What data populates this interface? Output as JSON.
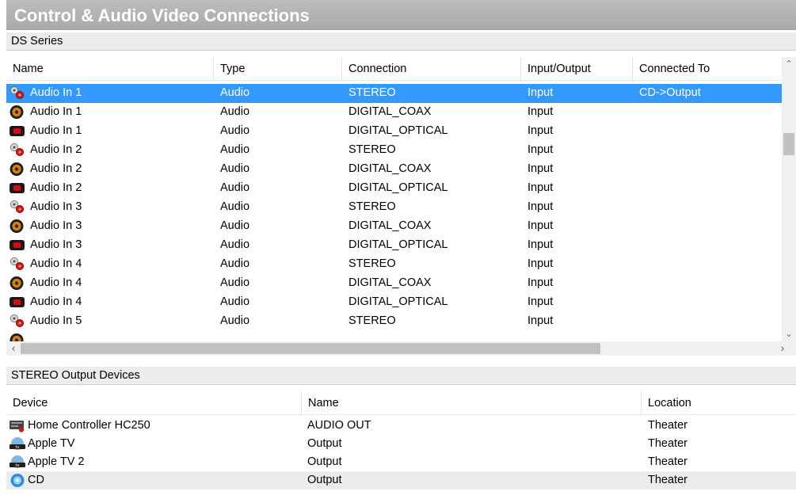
{
  "window": {
    "title": "Control & Audio Video Connections"
  },
  "top_section": {
    "title": "DS Series",
    "columns": [
      "Name",
      "Type",
      "Connection",
      "Input/Output",
      "Connected To"
    ],
    "rows": [
      {
        "icon": "stereo-plug-icon",
        "name": "Audio In 1",
        "type": "Audio",
        "connection": "STEREO",
        "io": "Input",
        "connected_to": "CD->Output",
        "selected": true
      },
      {
        "icon": "coax-jack-icon",
        "name": "Audio In 1",
        "type": "Audio",
        "connection": "DIGITAL_COAX",
        "io": "Input",
        "connected_to": ""
      },
      {
        "icon": "optical-port-icon",
        "name": "Audio In 1",
        "type": "Audio",
        "connection": "DIGITAL_OPTICAL",
        "io": "Input",
        "connected_to": ""
      },
      {
        "icon": "stereo-plug-icon",
        "name": "Audio In 2",
        "type": "Audio",
        "connection": "STEREO",
        "io": "Input",
        "connected_to": ""
      },
      {
        "icon": "coax-jack-icon",
        "name": "Audio In 2",
        "type": "Audio",
        "connection": "DIGITAL_COAX",
        "io": "Input",
        "connected_to": ""
      },
      {
        "icon": "optical-port-icon",
        "name": "Audio In 2",
        "type": "Audio",
        "connection": "DIGITAL_OPTICAL",
        "io": "Input",
        "connected_to": ""
      },
      {
        "icon": "stereo-plug-icon",
        "name": "Audio In 3",
        "type": "Audio",
        "connection": "STEREO",
        "io": "Input",
        "connected_to": ""
      },
      {
        "icon": "coax-jack-icon",
        "name": "Audio In 3",
        "type": "Audio",
        "connection": "DIGITAL_COAX",
        "io": "Input",
        "connected_to": ""
      },
      {
        "icon": "optical-port-icon",
        "name": "Audio In 3",
        "type": "Audio",
        "connection": "DIGITAL_OPTICAL",
        "io": "Input",
        "connected_to": ""
      },
      {
        "icon": "stereo-plug-icon",
        "name": "Audio In 4",
        "type": "Audio",
        "connection": "STEREO",
        "io": "Input",
        "connected_to": ""
      },
      {
        "icon": "coax-jack-icon",
        "name": "Audio In 4",
        "type": "Audio",
        "connection": "DIGITAL_COAX",
        "io": "Input",
        "connected_to": ""
      },
      {
        "icon": "optical-port-icon",
        "name": "Audio In 4",
        "type": "Audio",
        "connection": "DIGITAL_OPTICAL",
        "io": "Input",
        "connected_to": ""
      },
      {
        "icon": "stereo-plug-icon",
        "name": "Audio In 5",
        "type": "Audio",
        "connection": "STEREO",
        "io": "Input",
        "connected_to": ""
      }
    ]
  },
  "bottom_section": {
    "title": "STEREO Output Devices",
    "columns": [
      "Device",
      "Name",
      "Location"
    ],
    "rows": [
      {
        "icon": "controller-icon",
        "device": "Home Controller HC250",
        "name": "AUDIO OUT",
        "location": "Theater"
      },
      {
        "icon": "apple-tv-icon",
        "device": "Apple TV",
        "name": "Output",
        "location": "Theater"
      },
      {
        "icon": "apple-tv-icon",
        "device": "Apple TV 2",
        "name": "Output",
        "location": "Theater"
      },
      {
        "icon": "cd-icon",
        "device": "CD",
        "name": "Output",
        "location": "Theater",
        "highlighted": true
      }
    ]
  },
  "colors": {
    "title_bar": "#a9a9a9",
    "selection": "#3399ff",
    "header_bg": "#ececec"
  }
}
